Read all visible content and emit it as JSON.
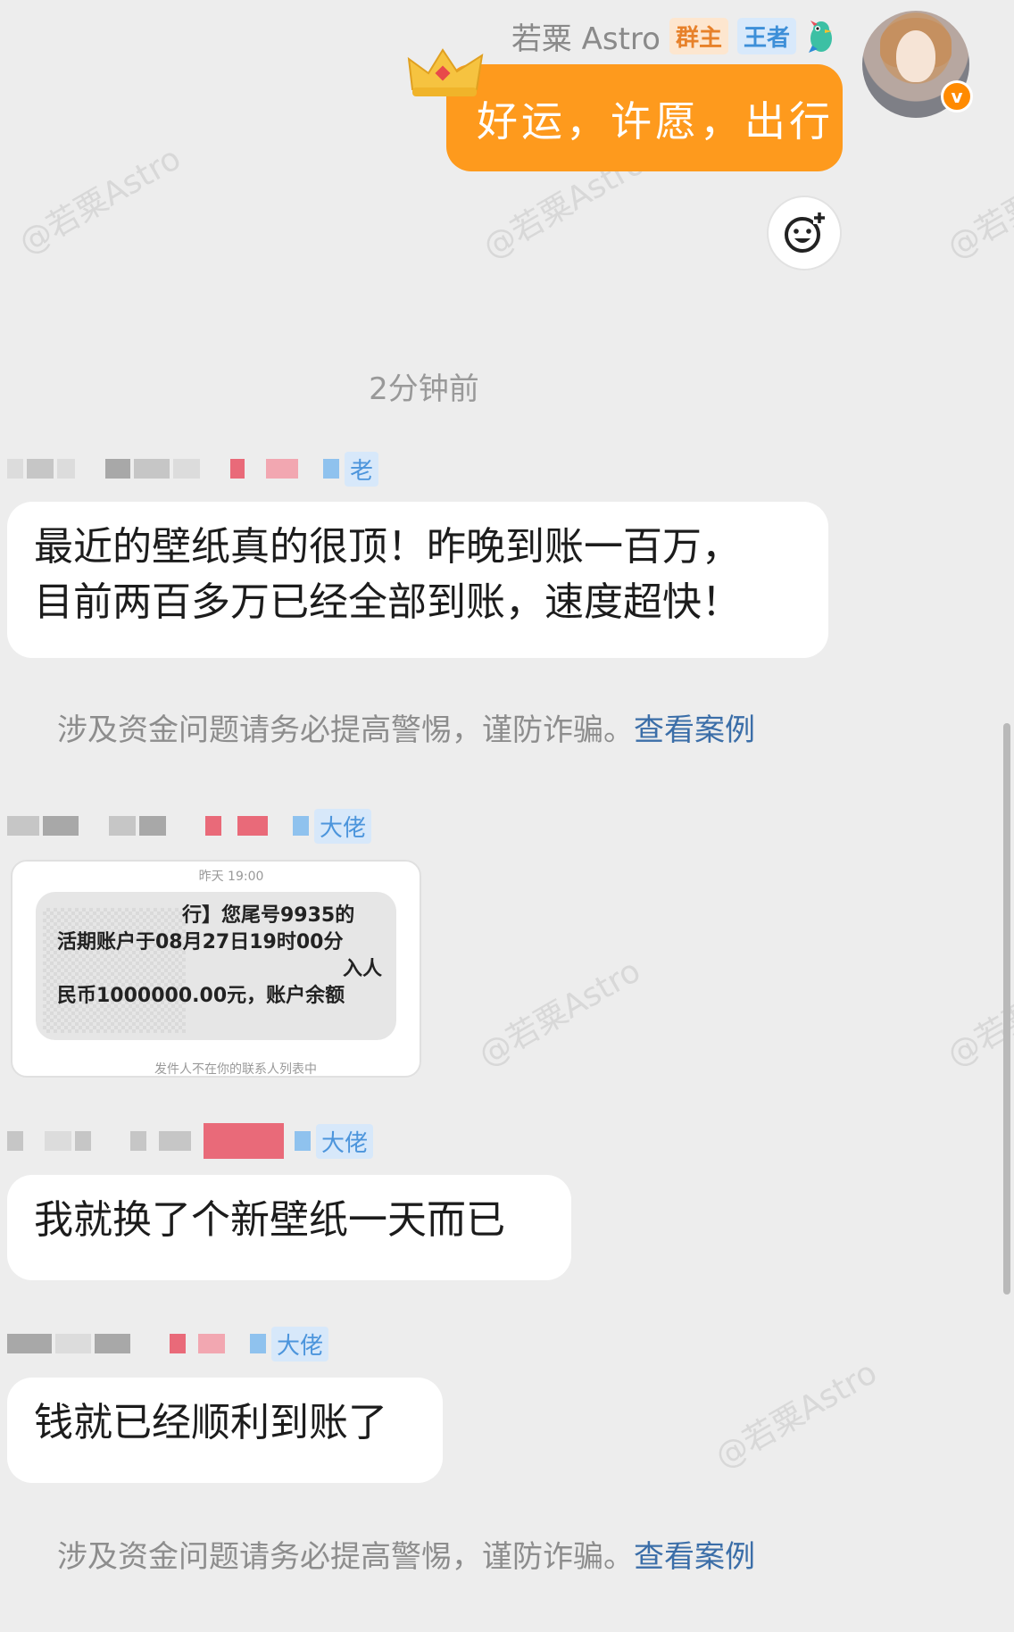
{
  "watermark": "@若粟Astro",
  "self_message": {
    "name": "若粟 Astro",
    "tag_owner": "群主",
    "tag_king": "王者",
    "text": "好运，许愿，出行",
    "badge": "v"
  },
  "time_divider": "2分钟前",
  "messages": [
    {
      "tag": "老",
      "text_line1": "最近的壁纸真的很顶！昨晚到账一百万，",
      "text_line2": "目前两百多万已经全部到账，速度超快！"
    },
    {
      "tag": "大佬",
      "sms": {
        "time": "昨天 19:00",
        "line1": "行】您尾号9935的",
        "line2": "活期账户于08月27日19时00分",
        "line3": "入人",
        "line4": "民币1000000.00元，账户余额",
        "footer": "发件人不在你的联系人列表中"
      }
    },
    {
      "tag": "大佬",
      "text": "我就换了个新壁纸一天而已"
    },
    {
      "tag": "大佬",
      "text": "钱就已经顺利到账了"
    }
  ],
  "warning": {
    "text": "涉及资金问题请务必提高警惕，谨防诈骗。",
    "link": "查看案例"
  }
}
